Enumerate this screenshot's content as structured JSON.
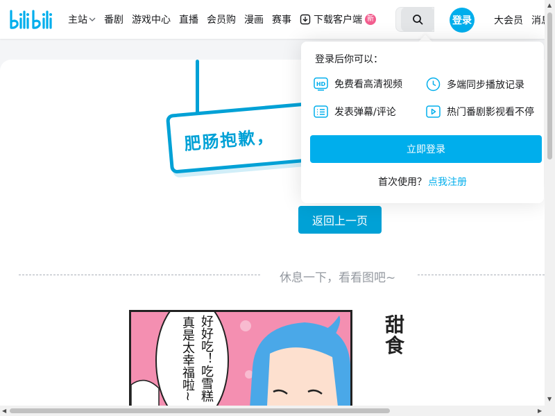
{
  "header": {
    "logo_text": "bilibili",
    "nav": [
      {
        "label": "主站"
      },
      {
        "label": "番剧"
      },
      {
        "label": "游戏中心"
      },
      {
        "label": "直播"
      },
      {
        "label": "会员购"
      },
      {
        "label": "漫画"
      },
      {
        "label": "赛事"
      },
      {
        "label": "下载客户端"
      }
    ],
    "download_badge": "新",
    "login_label": "登录",
    "vip_label": "大会员",
    "message_label": "消息"
  },
  "main": {
    "sign_text": "肥肠抱歉，",
    "back_button": "返回上一页",
    "rest_text": "休息一下，看看图吧~",
    "comic_bubble_right": "好好吃！吃雪糕",
    "comic_bubble_left": "真是太幸福啦~",
    "comic_title": "甜食"
  },
  "popover": {
    "title": "登录后你可以：",
    "benefits": [
      {
        "label": "免费看高清视频",
        "icon": "hd-icon"
      },
      {
        "label": "多端同步播放记录",
        "icon": "clock-icon"
      },
      {
        "label": "发表弹幕/评论",
        "icon": "comment-list-icon"
      },
      {
        "label": "热门番剧影视看不停",
        "icon": "play-icon"
      }
    ],
    "login_button": "立即登录",
    "first_use_text": "首次使用？",
    "register_link": "点我注册"
  },
  "colors": {
    "brand_blue": "#00aeec",
    "sign_blue": "#00a1d6",
    "badge_pink": "#f25d8e"
  }
}
